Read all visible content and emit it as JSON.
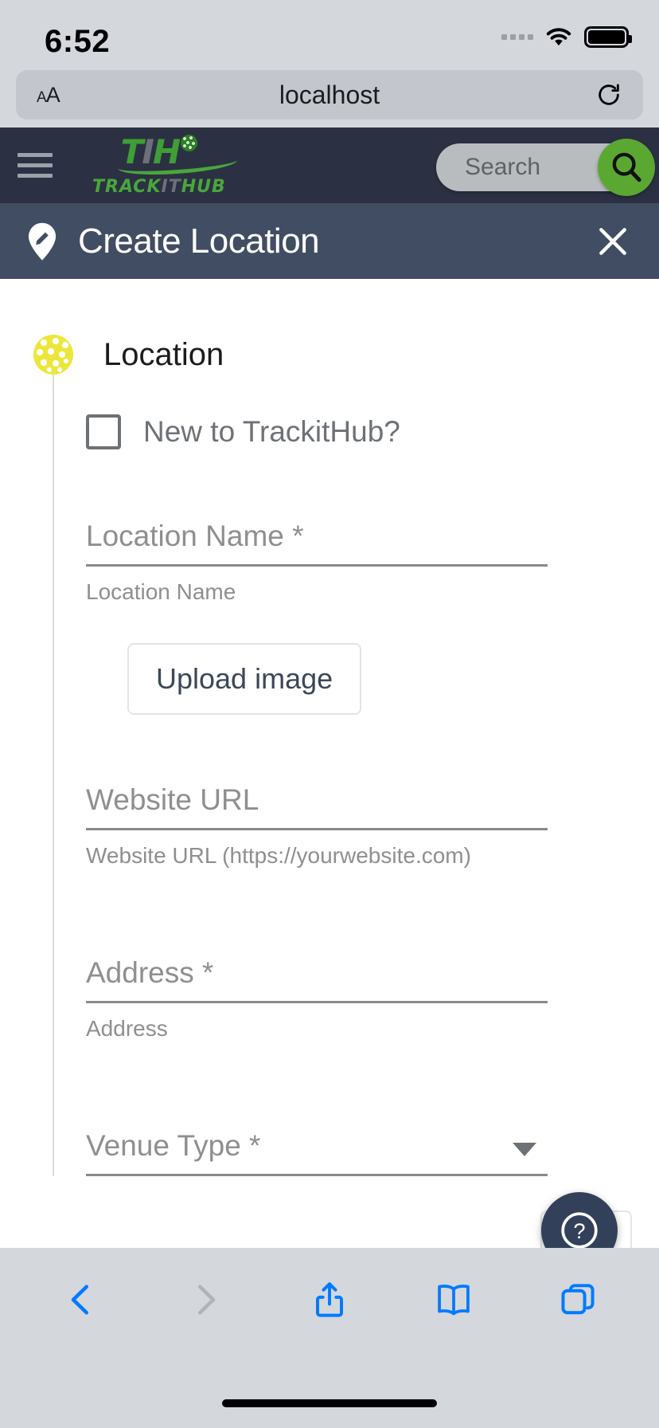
{
  "status_bar": {
    "time": "6:52",
    "cellular_icon": "cellular-dots-icon",
    "wifi_icon": "wifi-icon",
    "battery_icon": "battery-full-icon"
  },
  "browser": {
    "text_size_label": "AA",
    "url": "localhost",
    "reload_icon": "reload-icon",
    "toolbar": {
      "back_icon": "back-chevron-icon",
      "forward_icon": "forward-chevron-icon",
      "share_icon": "share-icon",
      "bookmarks_icon": "bookmarks-book-icon",
      "tabs_icon": "tabs-icon"
    }
  },
  "app_header": {
    "menu_icon": "hamburger-menu-icon",
    "logo": {
      "part_t": "T",
      "part_i": "I",
      "part_h": "H",
      "sub_track": "TRACK",
      "sub_it": "IT",
      "sub_hub": "HUB",
      "ball_icon": "pickleball-icon"
    },
    "search_placeholder": "Search",
    "search_icon": "search-magnifier-icon"
  },
  "page_title_bar": {
    "icon": "location-pin-edit-icon",
    "title": "Create Location",
    "close_icon": "close-x-icon"
  },
  "form": {
    "section_icon": "pickleball-icon",
    "section_title": "Location",
    "new_user_checkbox": {
      "label": "New to TrackitHub?",
      "checked": false
    },
    "fields": [
      {
        "label": "Location Name *",
        "value": "",
        "hint": "Location Name",
        "type": "text"
      },
      {
        "label": "Website URL",
        "value": "",
        "hint": "Website URL (https://yourwebsite.com)",
        "type": "text"
      },
      {
        "label": "Address *",
        "value": "",
        "hint": "Address",
        "type": "text"
      },
      {
        "label": "Venue Type *",
        "value": "",
        "hint": "",
        "type": "select"
      }
    ],
    "upload_button": "Upload image",
    "help_icon": "question-mark-help-icon"
  },
  "colors": {
    "header_dark": "#2b3142",
    "title_band": "#414d63",
    "brand_green": "#4aa63c",
    "search_green": "#5aa832",
    "pickleball_yellow": "#ece63a",
    "fab_navy": "#32405a",
    "safari_chrome": "#d4d7dc",
    "safari_blue": "#007aff"
  }
}
